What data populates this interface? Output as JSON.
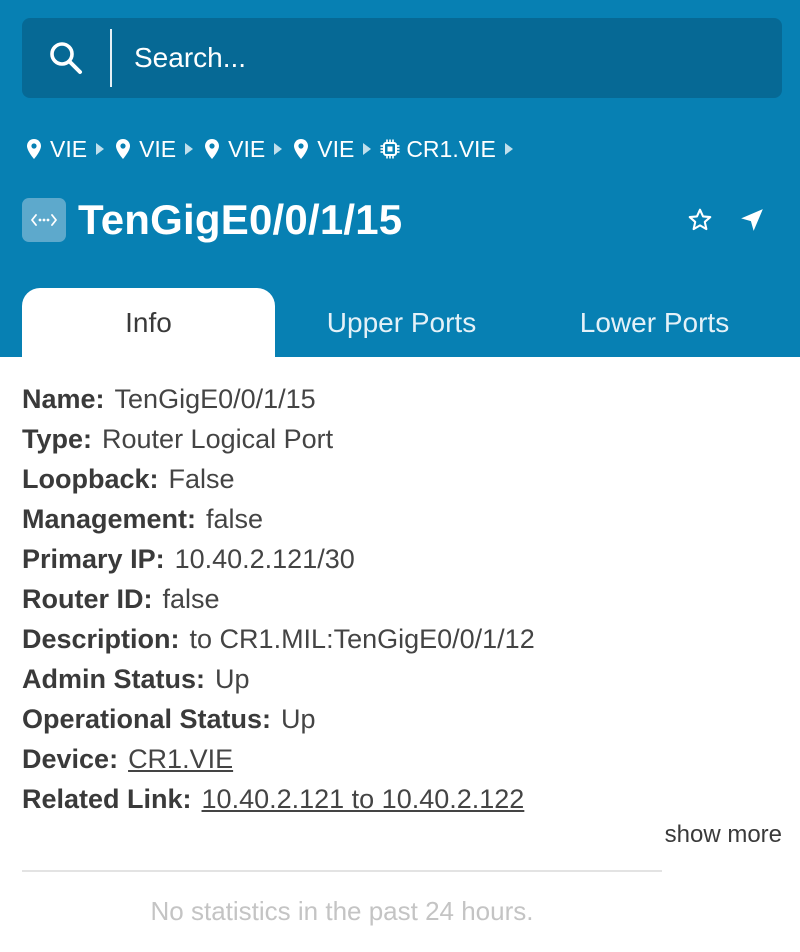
{
  "search": {
    "placeholder": "Search..."
  },
  "breadcrumb": {
    "items": [
      {
        "label": "VIE",
        "icon": "location-pin-icon"
      },
      {
        "label": "VIE",
        "icon": "location-pin-icon"
      },
      {
        "label": "VIE",
        "icon": "location-pin-icon"
      },
      {
        "label": "VIE",
        "icon": "location-pin-icon"
      },
      {
        "label": "CR1.VIE",
        "icon": "chip-icon"
      }
    ]
  },
  "header": {
    "title": "TenGigE0/0/1/15",
    "badge_icon": "port-icon",
    "actions": [
      "star-icon",
      "navigate-arrow-icon"
    ]
  },
  "tabs": [
    {
      "label": "Info",
      "active": true
    },
    {
      "label": "Upper Ports",
      "active": false
    },
    {
      "label": "Lower Ports",
      "active": false
    }
  ],
  "info": {
    "fields": [
      {
        "label": "Name:",
        "value": "TenGigE0/0/1/15"
      },
      {
        "label": "Type:",
        "value": "Router Logical Port"
      },
      {
        "label": "Loopback:",
        "value": "False"
      },
      {
        "label": "Management:",
        "value": "false"
      },
      {
        "label": "Primary IP:",
        "value": "10.40.2.121/30"
      },
      {
        "label": "Router ID:",
        "value": "false"
      },
      {
        "label": "Description:",
        "value": "to CR1.MIL:TenGigE0/0/1/12"
      },
      {
        "label": "Admin Status:",
        "value": "Up"
      },
      {
        "label": "Operational Status:",
        "value": "Up"
      },
      {
        "label": "Device:",
        "value": "CR1.VIE"
      },
      {
        "label": "Related Link:",
        "value": "10.40.2.121 to 10.40.2.122"
      }
    ],
    "show_more": "show more",
    "no_stats": "No statistics in the past 24 hours."
  },
  "colors": {
    "header_bg": "#0780b3",
    "search_bg": "#066995",
    "badge_bg": "#5da9cc",
    "muted_text": "#c4c4c4"
  }
}
